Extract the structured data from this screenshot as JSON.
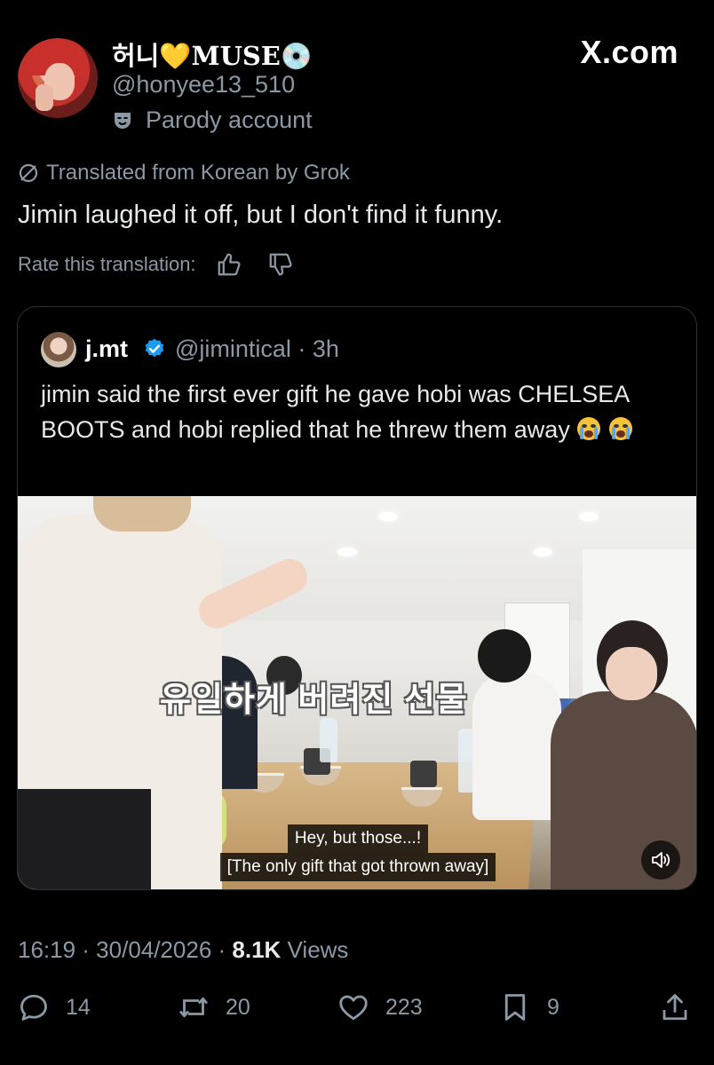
{
  "author": {
    "display_name": "허니💛MUSE💿",
    "handle": "@honyee13_510",
    "parody_label": "Parody account"
  },
  "brand": "X.com",
  "translation": {
    "label": "Translated from Korean by Grok",
    "text": "Jimin laughed it off, but I don't find it funny.",
    "rate_label": "Rate this translation:"
  },
  "quoted": {
    "name": "j.mt",
    "handle_time": "@jimintical · 3h",
    "text": "jimin said the first ever gift he gave hobi was CHELSEA BOOTS and hobi replied that he threw them away",
    "video": {
      "korean_caption": "유일하게 버려진 선물",
      "subtitle_line1": "Hey, but those...!",
      "subtitle_line2": "[The only gift that got thrown away]"
    }
  },
  "meta": {
    "timestamp": "16:19 · 30/04/2026 · ",
    "views_count": "8.1K",
    "views_label": " Views"
  },
  "actions": {
    "replies": "14",
    "reposts": "20",
    "likes": "223",
    "bookmarks": "9"
  },
  "colors": {
    "background": "#000000",
    "text": "#e7e9ea",
    "muted": "#8b98a5",
    "border": "#2f3336",
    "verified": "#1d9bf0"
  }
}
